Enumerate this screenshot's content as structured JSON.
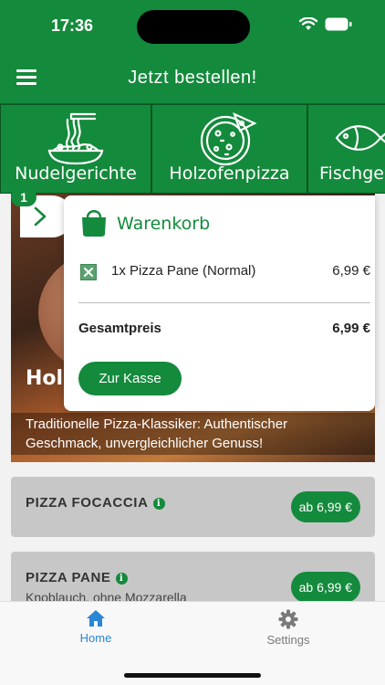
{
  "status_bar": {
    "time": "17:36"
  },
  "nav": {
    "title": "Jetzt bestellen!"
  },
  "categories": [
    {
      "label": "Nudelgerichte",
      "icon": "noodles-icon"
    },
    {
      "label": "Holzofenpizza",
      "icon": "pizza-icon"
    },
    {
      "label": "Fischgerichte",
      "icon": "fish-icon"
    }
  ],
  "hero": {
    "title": "Holzofenpizza",
    "description": "Traditionelle Pizza-Klassiker: Authentischer Geschmack, unvergleichlicher Genuss!"
  },
  "cart": {
    "count": "1",
    "title": "Warenkorb",
    "items": [
      {
        "name": "1x Pizza Pane (Normal)",
        "price": "6,99 €"
      }
    ],
    "total_label": "Gesamtpreis",
    "total_value": "6,99 €",
    "checkout_label": "Zur Kasse"
  },
  "products": [
    {
      "name": "PIZZA FOCACCIA",
      "description": "",
      "price": "ab 6,99 €"
    },
    {
      "name": "PIZZA PANE",
      "description": "Knoblauch, ohne Mozzarella",
      "price": "ab 6,99 €"
    }
  ],
  "tabs": [
    {
      "label": "Home",
      "icon": "home-icon",
      "active": true
    },
    {
      "label": "Settings",
      "icon": "gear-icon",
      "active": false
    }
  ],
  "colors": {
    "brand": "#148a3c",
    "active_tab": "#2a86d6",
    "inactive_tab": "#7a7a7a"
  }
}
